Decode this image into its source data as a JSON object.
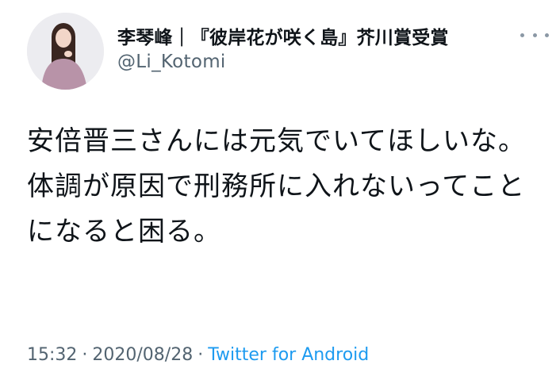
{
  "author": {
    "display_name": "李琴峰｜『彼岸花が咲く島』芥川賞受賞",
    "handle": "@Li_Kotomi",
    "avatar_icon": "profile-photo"
  },
  "more_icon": "more-dots-icon",
  "tweet": {
    "text": "安倍晋三さんには元気でいてほしいな。\n体調が原因で刑務所に入れないってことになると困る。"
  },
  "meta": {
    "time": "15:32",
    "date": "2020/08/28",
    "separator": "·",
    "source": "Twitter for Android"
  },
  "colors": {
    "text": "#0f1419",
    "secondary": "#536471",
    "link": "#1d9bf0"
  }
}
